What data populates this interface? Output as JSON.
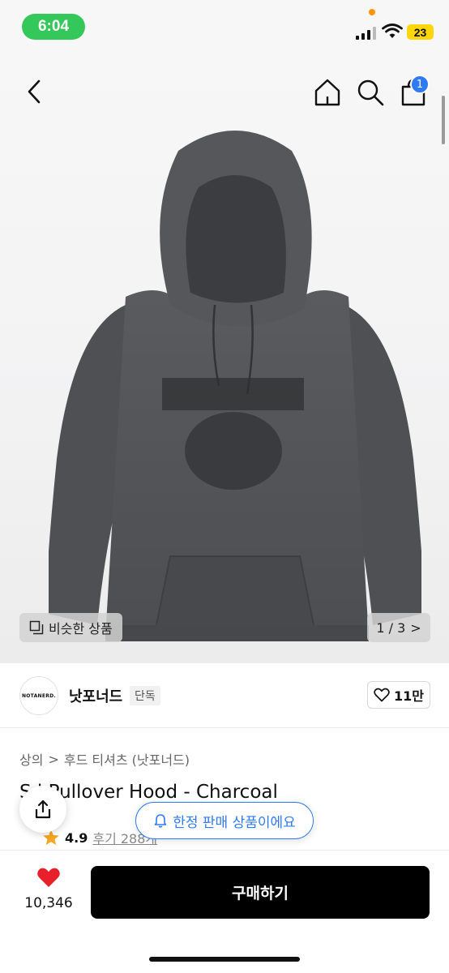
{
  "status": {
    "time": "6:04",
    "battery": "23"
  },
  "header": {
    "cart_count": "1"
  },
  "gallery": {
    "similar_label": "비슷한 상품",
    "page_indicator": "1 / 3",
    "next_glyph": ">"
  },
  "brand": {
    "logo_text": "NOTANERD.",
    "name": "낫포너드",
    "badge": "단독",
    "like_count": "11만"
  },
  "product": {
    "breadcrumb": [
      "상의",
      "후드 티셔츠 (낫포너드)"
    ],
    "breadcrumb_separator": ">",
    "title": "S   l Pullover Hood - Charcoal",
    "rating": "4.9",
    "reviews": "후기 288개"
  },
  "overlay": {
    "limited_label": "한정 판매 상품이에요"
  },
  "bottom": {
    "wish_count": "10,346",
    "buy_label": "구매하기"
  },
  "colors": {
    "accent": "#2f7bf5",
    "heart": "#e8202a",
    "star": "#f5a623",
    "time_pill": "#34c759",
    "battery": "#ffd60a"
  }
}
